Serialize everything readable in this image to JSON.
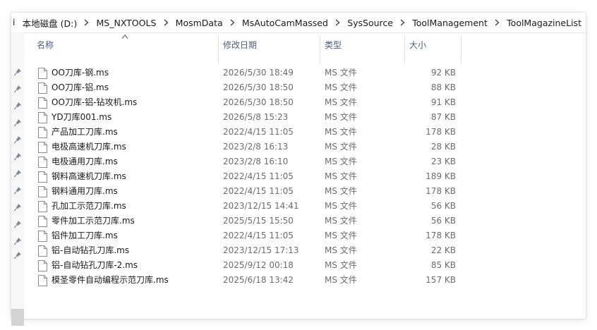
{
  "breadcrumb": {
    "cut_fragment": "i",
    "segments": [
      "本地磁盘 (D:)",
      "MS_NXTOOLS",
      "MosmData",
      "MsAutoCamMassed",
      "SysSource",
      "ToolManagement",
      "ToolMagazineList"
    ]
  },
  "columns": {
    "name": "名称",
    "date": "修改日期",
    "type": "类型",
    "size": "大小"
  },
  "icons": {
    "file": "file-icon",
    "pin": "pin-icon",
    "sort": "sort-ascending-icon",
    "separator": "chevron-right-icon"
  },
  "files": [
    {
      "name": "OO刀库-钢.ms",
      "date": "2026/5/30 18:49",
      "type": "MS 文件",
      "size": "92 KB"
    },
    {
      "name": "OO刀库-铝.ms",
      "date": "2026/5/30 18:50",
      "type": "MS 文件",
      "size": "88 KB"
    },
    {
      "name": "OO刀库-铝-钻攻机.ms",
      "date": "2026/5/30 18:50",
      "type": "MS 文件",
      "size": "91 KB"
    },
    {
      "name": "YD刀库001.ms",
      "date": "2026/5/8 15:23",
      "type": "MS 文件",
      "size": "87 KB"
    },
    {
      "name": "产品加工刀库.ms",
      "date": "2022/4/15 11:05",
      "type": "MS 文件",
      "size": "178 KB"
    },
    {
      "name": "电极高速机刀库.ms",
      "date": "2023/2/8 16:13",
      "type": "MS 文件",
      "size": "28 KB"
    },
    {
      "name": "电极通用刀库.ms",
      "date": "2023/2/8 16:10",
      "type": "MS 文件",
      "size": "23 KB"
    },
    {
      "name": "钢料高速机刀库.ms",
      "date": "2022/4/15 11:05",
      "type": "MS 文件",
      "size": "189 KB"
    },
    {
      "name": "钢料通用刀库.ms",
      "date": "2022/4/15 11:05",
      "type": "MS 文件",
      "size": "178 KB"
    },
    {
      "name": "孔加工示范刀库.ms",
      "date": "2023/12/15 14:41",
      "type": "MS 文件",
      "size": "56 KB"
    },
    {
      "name": "零件加工示范刀库.ms",
      "date": "2025/5/15 15:50",
      "type": "MS 文件",
      "size": "56 KB"
    },
    {
      "name": "铝件加工刀库.ms",
      "date": "2022/4/15 11:05",
      "type": "MS 文件",
      "size": "178 KB"
    },
    {
      "name": "铝-自动钻孔刀库.ms",
      "date": "2023/12/15 17:13",
      "type": "MS 文件",
      "size": "22 KB"
    },
    {
      "name": "铝-自动钻孔刀库-2.ms",
      "date": "2025/9/12 00:18",
      "type": "MS 文件",
      "size": "85 KB"
    },
    {
      "name": "模圣零件自动编程示范刀库.ms",
      "date": "2025/6/18 13:42",
      "type": "MS 文件",
      "size": "157 KB"
    }
  ],
  "colors": {
    "header_text": "#4c607a",
    "secondary_text": "#6d6d6d",
    "hover": "#e5f3ff"
  }
}
